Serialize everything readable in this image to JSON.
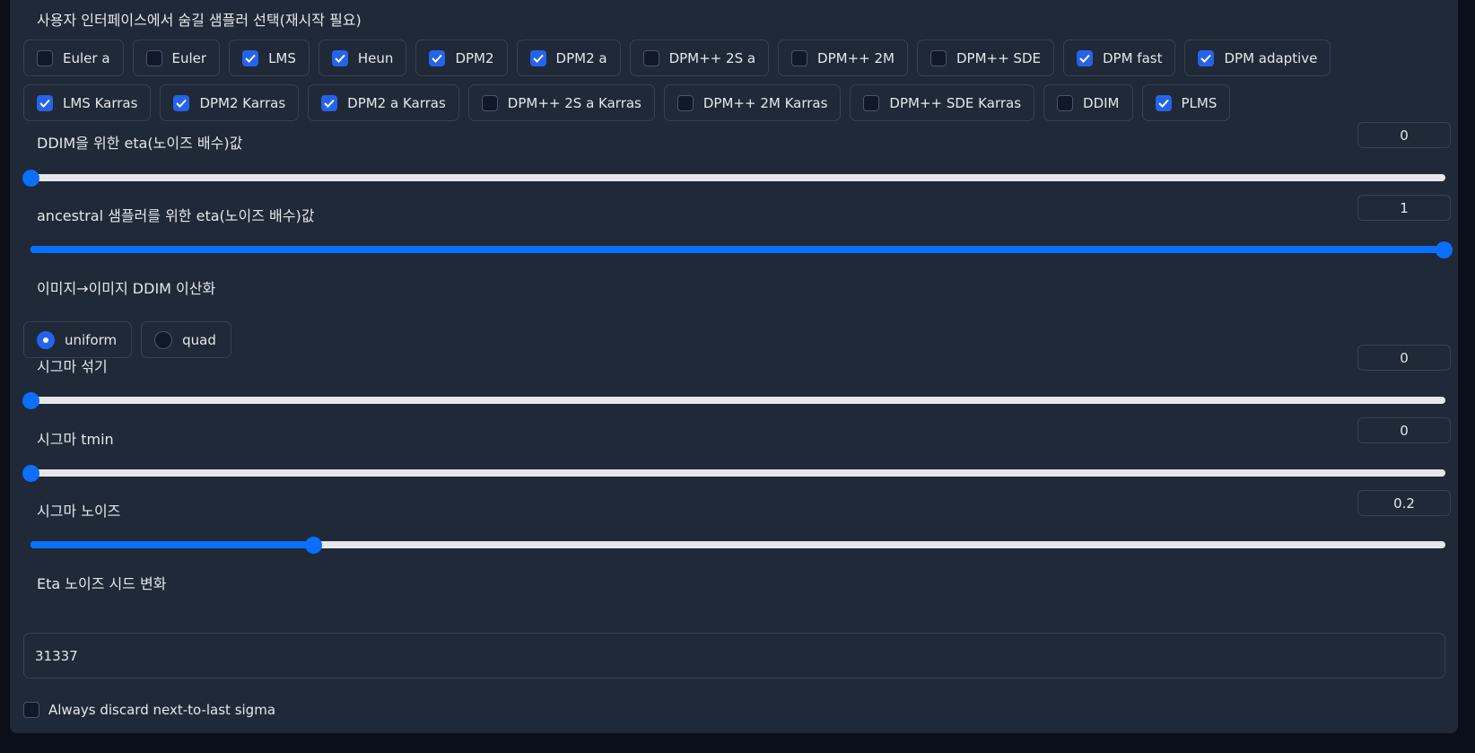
{
  "hidden_samplers": {
    "label": "사용자 인터페이스에서 숨길 샘플러 선택(재시작 필요)",
    "row1": [
      {
        "label": "Euler a",
        "checked": false
      },
      {
        "label": "Euler",
        "checked": false
      },
      {
        "label": "LMS",
        "checked": true
      },
      {
        "label": "Heun",
        "checked": true
      },
      {
        "label": "DPM2",
        "checked": true
      },
      {
        "label": "DPM2 a",
        "checked": true
      },
      {
        "label": "DPM++ 2S a",
        "checked": false
      },
      {
        "label": "DPM++ 2M",
        "checked": false
      },
      {
        "label": "DPM++ SDE",
        "checked": false
      },
      {
        "label": "DPM fast",
        "checked": true
      },
      {
        "label": "DPM adaptive",
        "checked": true
      }
    ],
    "row2": [
      {
        "label": "LMS Karras",
        "checked": true
      },
      {
        "label": "DPM2 Karras",
        "checked": true
      },
      {
        "label": "DPM2 a Karras",
        "checked": true
      },
      {
        "label": "DPM++ 2S a Karras",
        "checked": false
      },
      {
        "label": "DPM++ 2M Karras",
        "checked": false
      },
      {
        "label": "DPM++ SDE Karras",
        "checked": false
      },
      {
        "label": "DDIM",
        "checked": false
      },
      {
        "label": "PLMS",
        "checked": true
      }
    ]
  },
  "eta_ddim": {
    "label": "DDIM을 위한 eta(노이즈 배수)값",
    "value": "0",
    "fraction": 0
  },
  "eta_ancestral": {
    "label": "ancestral 샘플러를 위한 eta(노이즈 배수)값",
    "value": "1",
    "fraction": 1
  },
  "ddim_discretize": {
    "label": "이미지→이미지 DDIM 이산화",
    "options": [
      {
        "label": "uniform",
        "selected": true
      },
      {
        "label": "quad",
        "selected": false
      }
    ]
  },
  "sigma_churn": {
    "label": "시그마 섞기",
    "value": "0",
    "fraction": 0
  },
  "sigma_tmin": {
    "label": "시그마 tmin",
    "value": "0",
    "fraction": 0
  },
  "sigma_noise": {
    "label": "시그마 노이즈",
    "value": "0.2",
    "fraction": 0.2
  },
  "eta_noise_seed": {
    "label": "Eta 노이즈 시드 변화",
    "value": "31337"
  },
  "always_discard": {
    "label": "Always discard next-to-last sigma",
    "checked": false
  }
}
